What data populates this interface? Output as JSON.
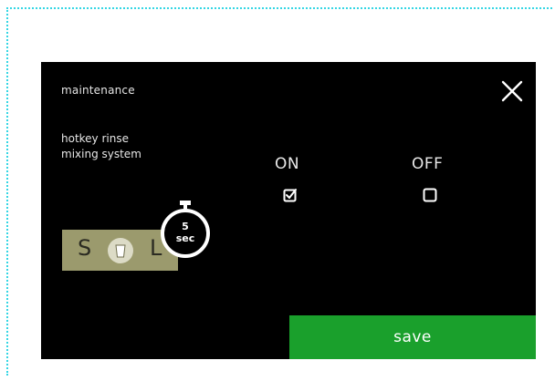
{
  "screen": {
    "title": "maintenance",
    "setting_label_line1": "hotkey rinse",
    "setting_label_line2": "mixing system"
  },
  "options": {
    "on_label": "ON",
    "on_checked": true,
    "off_label": "OFF",
    "off_checked": false
  },
  "hotkey": {
    "left_letter": "S",
    "right_letter": "L"
  },
  "timer": {
    "value": "5",
    "unit": "sec"
  },
  "actions": {
    "save_label": "save"
  },
  "colors": {
    "background": "#000000",
    "save_button": "#1aa02c",
    "hotkey_panel": "#9b9a6d",
    "frame_border": "#34d6e4"
  },
  "icons": {
    "close": "close-icon",
    "on_checkbox": "checked-checkbox-icon",
    "off_checkbox": "unchecked-checkbox-icon",
    "timer": "stopwatch-icon",
    "cup": "cup-icon"
  }
}
